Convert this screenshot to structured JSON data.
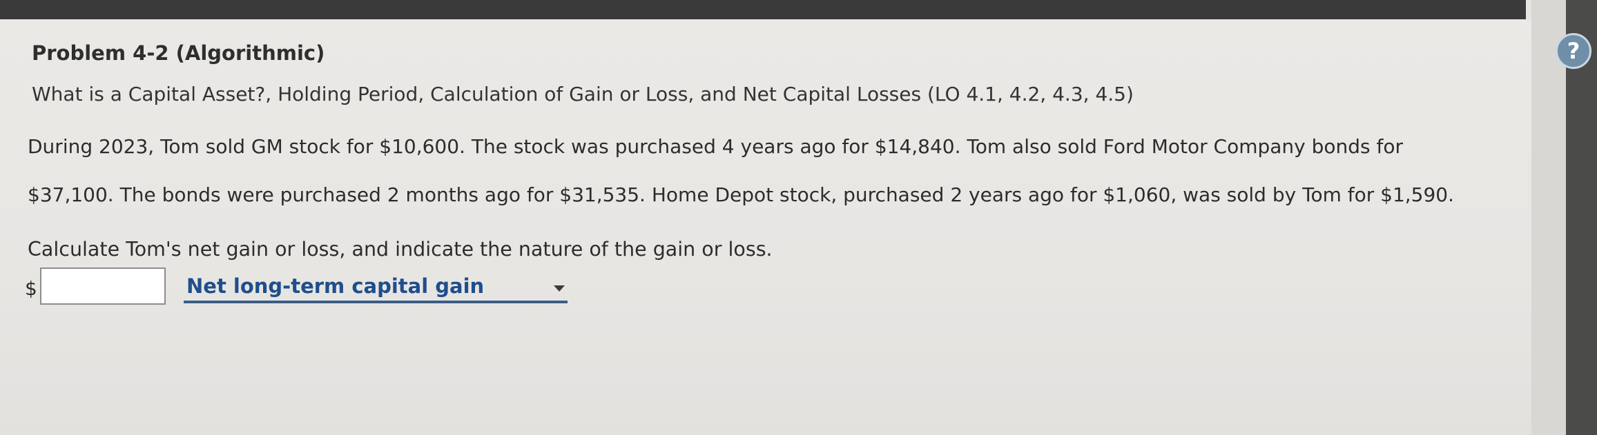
{
  "problem": {
    "title": "Problem 4-2 (Algorithmic)",
    "subtitle": "What is a Capital Asset?, Holding Period, Calculation of Gain or Loss, and Net Capital Losses (LO 4.1, 4.2, 4.3, 4.5)",
    "paragraph_line_1": "During 2023, Tom sold GM stock for $10,600. The stock was purchased 4 years ago for $14,840. Tom also sold Ford Motor Company bonds for",
    "paragraph_line_2": "$37,100. The bonds were purchased 2 months ago for $31,535. Home Depot stock, purchased 2 years ago for $1,060, was sold by Tom for $1,590.",
    "question": "Calculate Tom's net gain or loss, and indicate the nature of the gain or loss."
  },
  "answer": {
    "currency_symbol": "$",
    "amount_value": "",
    "nature_selected": "Net long-term capital gain"
  },
  "help": {
    "icon_glyph": "?",
    "icon": "help-icon",
    "color": "#6f8fa8"
  },
  "colors": {
    "select_text": "#1f4e8c",
    "select_underline": "#3c5d85"
  }
}
